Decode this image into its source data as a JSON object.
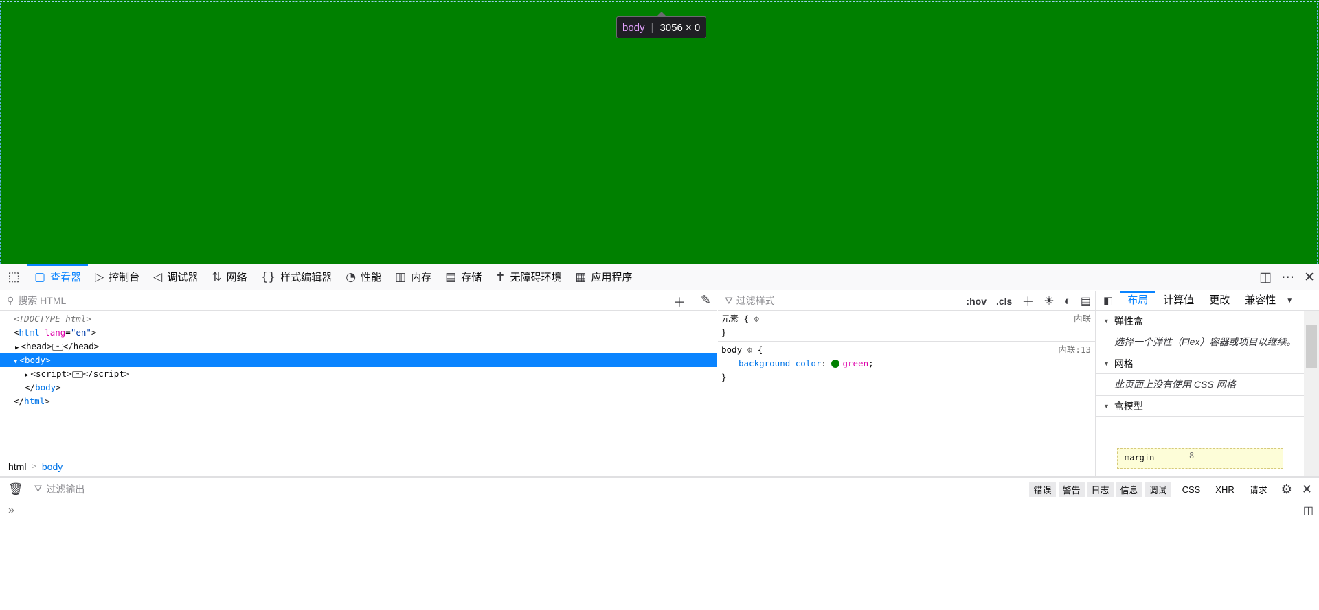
{
  "viewport": {
    "background": "#008000"
  },
  "infobar": {
    "tag": "body",
    "dims": "3056 × 0"
  },
  "tabs": [
    {
      "label": "查看器",
      "icon": "inspector-icon",
      "glyph": "▢"
    },
    {
      "label": "控制台",
      "icon": "console-icon",
      "glyph": "▷"
    },
    {
      "label": "调试器",
      "icon": "debugger-icon",
      "glyph": "◁"
    },
    {
      "label": "网络",
      "icon": "network-icon",
      "glyph": "⇅"
    },
    {
      "label": "样式编辑器",
      "icon": "style-editor-icon",
      "glyph": "{}"
    },
    {
      "label": "性能",
      "icon": "performance-icon",
      "glyph": "◔"
    },
    {
      "label": "内存",
      "icon": "memory-icon",
      "glyph": "▥"
    },
    {
      "label": "存储",
      "icon": "storage-icon",
      "glyph": "▤"
    },
    {
      "label": "无障碍环境",
      "icon": "accessibility-icon",
      "glyph": "✝"
    },
    {
      "label": "应用程序",
      "icon": "application-icon",
      "glyph": "▦"
    }
  ],
  "markup": {
    "search_placeholder": "搜索 HTML",
    "lines": {
      "doctype": "<!DOCTYPE html>",
      "html_open_tag": "html",
      "html_attr_name": "lang",
      "html_attr_value": "\"en\"",
      "head_tag": "head",
      "body_tag": "body",
      "script_tag": "script",
      "body_close": "body",
      "html_close": "html"
    }
  },
  "breadcrumb": [
    "html",
    "body"
  ],
  "rules": {
    "filter_placeholder": "过滤样式",
    "hov": ":hov",
    "cls": ".cls",
    "element_selector": "元素 {",
    "element_source": "内联",
    "body_selector": "body",
    "body_source": "内联:13",
    "prop_name": "background-color",
    "prop_value": "green"
  },
  "side_tabs": [
    "布局",
    "计算值",
    "更改",
    "兼容性"
  ],
  "layout_sections": {
    "flexbox_title": "弹性盒",
    "flexbox_text": "选择一个弹性（Flex）容器或项目以继续。",
    "grid_title": "网格",
    "grid_text": "此页面上没有使用 CSS 网格",
    "boxmodel_title": "盒模型",
    "margin_label": "margin",
    "margin_value": "8"
  },
  "console": {
    "filter_placeholder": "过滤输出",
    "filters": [
      "错误",
      "警告",
      "日志",
      "信息",
      "调试"
    ],
    "toggles": [
      "CSS",
      "XHR",
      "请求"
    ]
  }
}
